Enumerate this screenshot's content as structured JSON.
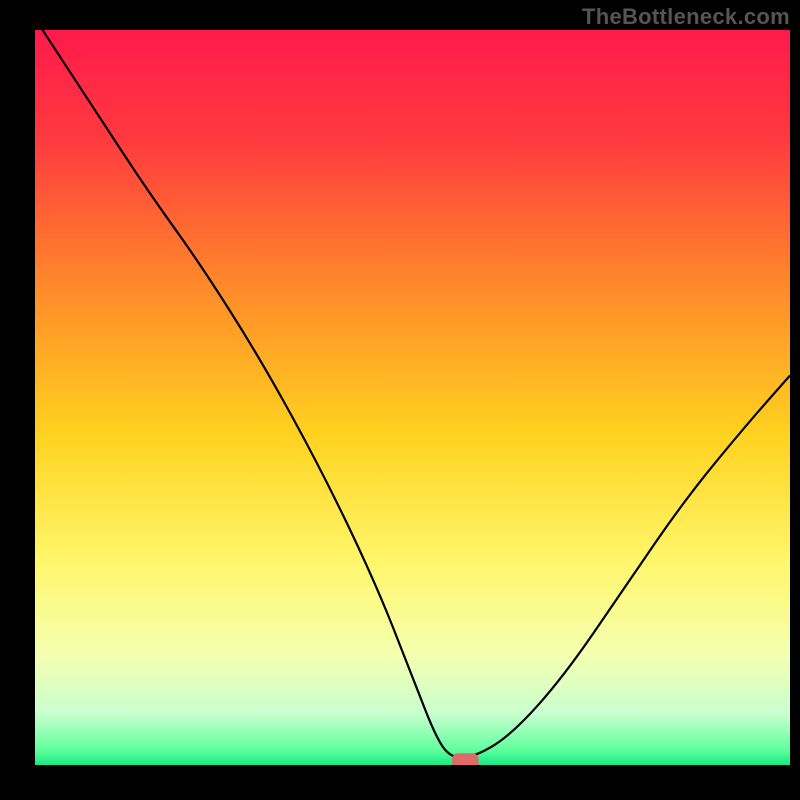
{
  "watermark": "TheBottleneck.com",
  "chart_data": {
    "type": "line",
    "title": "",
    "xlabel": "",
    "ylabel": "",
    "xlim": [
      0,
      100
    ],
    "ylim": [
      0,
      100
    ],
    "grid": false,
    "legend": false,
    "background": {
      "type": "vertical-gradient",
      "stops": [
        {
          "pos": 0.0,
          "color": "#ff1a4b"
        },
        {
          "pos": 0.15,
          "color": "#ff3a3f"
        },
        {
          "pos": 0.35,
          "color": "#ff8a2a"
        },
        {
          "pos": 0.55,
          "color": "#ffd21f"
        },
        {
          "pos": 0.72,
          "color": "#fff66a"
        },
        {
          "pos": 0.85,
          "color": "#f4ffb0"
        },
        {
          "pos": 0.93,
          "color": "#c9ffcf"
        },
        {
          "pos": 0.98,
          "color": "#5eff9d"
        },
        {
          "pos": 1.0,
          "color": "#17e884"
        }
      ]
    },
    "series": [
      {
        "name": "bottleneck-curve",
        "color": "#000000",
        "width": 2.2,
        "x": [
          1,
          8,
          15,
          22,
          30,
          38,
          45,
          50,
          53,
          55,
          58,
          63,
          70,
          78,
          86,
          94,
          100
        ],
        "y": [
          100,
          89,
          78,
          68,
          55,
          40,
          25,
          12,
          4,
          1,
          1,
          4,
          12,
          24,
          36,
          46,
          53
        ]
      }
    ],
    "marker": {
      "name": "optimal-point",
      "shape": "rounded-rect",
      "color": "#e06a6a",
      "x": 57,
      "y": 0.5,
      "w": 3.5,
      "h": 2.2
    }
  }
}
